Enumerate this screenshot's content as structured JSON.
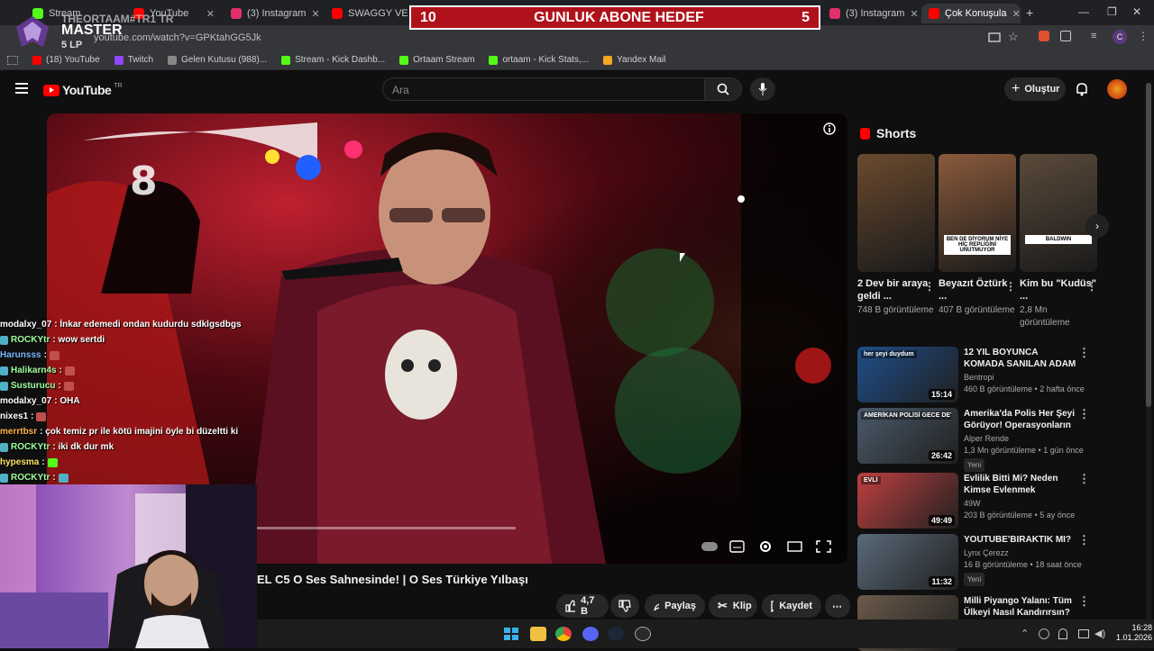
{
  "browser": {
    "tabs": [
      {
        "label": "Stream",
        "favicon_color": "#53fc18"
      },
      {
        "label": "YouTube",
        "favicon_color": "#ff0000"
      },
      {
        "label": "(3) Instagram",
        "favicon_color": "#e1306c"
      },
      {
        "label": "SWAGGY VE CAV",
        "favicon_color": "#ff0000"
      },
      {
        "label": "(3) Instagram",
        "favicon_color": "#e1306c"
      },
      {
        "label": "Çok Konuşula",
        "favicon_color": "#ff0000"
      }
    ],
    "new_tab_icon": "plus-icon",
    "url": "youtube.com/watch?v=GPKtahGG5Jk",
    "bookmarks": [
      {
        "label": "(18) YouTube",
        "color": "#ff0000"
      },
      {
        "label": "Twitch",
        "color": "#9146ff"
      },
      {
        "label": "Gelen Kutusu (988)...",
        "color": "#888888"
      },
      {
        "label": "Stream - Kick Dashb...",
        "color": "#53fc18"
      },
      {
        "label": "Ortaam Stream",
        "color": "#53fc18"
      },
      {
        "label": "ortaam - Kick Stats,...",
        "color": "#53fc18"
      },
      {
        "label": "Yandex Mail",
        "color": "#f5a623"
      }
    ]
  },
  "overlay": {
    "goal_left": "10",
    "goal_label": "GUNLUK ABONE HEDEF",
    "goal_right": "5",
    "streamer_name": "THEORTAAM#TR1 TR",
    "rank": "MASTER",
    "lp": "5 LP"
  },
  "youtube": {
    "logo_text": "YouTube",
    "region": "TR",
    "search_placeholder": "Ara",
    "create_label": "Oluştur",
    "video_title": "EL C5 O Ses Sahnesinde! | O Ses Türkiye Yılbaşı",
    "actions": {
      "likes": "4,7 B",
      "share": "Paylaş",
      "clip": "Klip",
      "save": "Kaydet"
    }
  },
  "chat": [
    {
      "user": "modalxy_07",
      "color": "#ffffff",
      "msg": ": İnkar edemedi ondan kudurdu sdklgsdbgs",
      "emote": ""
    },
    {
      "user": "ROCKYtr",
      "color": "#9effa0",
      "msg": ": wow sertdi",
      "emote": ""
    },
    {
      "user": "Harunsss",
      "color": "#7ab8ff",
      "msg": ":",
      "emote": "#c0504d"
    },
    {
      "user": "Halikarn4s",
      "color": "#9effa0",
      "msg": ":",
      "emote": "#c0504d"
    },
    {
      "user": "Susturucu",
      "color": "#9effa0",
      "msg": ":",
      "emote": "#c0504d"
    },
    {
      "user": "modalxy_07",
      "color": "#ffffff",
      "msg": ": OHA",
      "emote": ""
    },
    {
      "user": "nixes1",
      "color": "#ffffff",
      "msg": ":",
      "emote": "#c0504d"
    },
    {
      "user": "merrtbsr",
      "color": "#ffb347",
      "msg": ": çok temiz pr ile kötü imajini öyle bi düzeltti ki",
      "emote": ""
    },
    {
      "user": "ROCKYtr",
      "color": "#9effa0",
      "msg": ": iki dk dur mk",
      "emote": ""
    },
    {
      "user": "hypesma",
      "color": "#ffe066",
      "msg": ":",
      "emote": "#53fc18"
    },
    {
      "user": "ROCKYtr",
      "color": "#9effa0",
      "msg": ":",
      "emote": "#4fb0c6"
    }
  ],
  "shorts": {
    "title": "Shorts",
    "items": [
      {
        "title": "2 Dev bir araya geldi ...",
        "views": "748 B görüntüleme",
        "color": "#6b4a2e"
      },
      {
        "title": "Beyazıt Öztürk ...",
        "views": "407 B görüntüleme",
        "color": "#8a5a3c",
        "caption": "BEN DE DİYORUM NİYE HİÇ REPLİĞİNİ UNUTMUYOR"
      },
      {
        "title": "Kim bu \"Kudüs\" ...",
        "views": "2,8 Mn görüntüleme",
        "color": "#5a4a3a",
        "caption": "BALDWIN"
      }
    ]
  },
  "recommendations": [
    {
      "title": "12 YIL BOYUNCA KOMADA SANILAN ADAM",
      "channel": "Bentropi",
      "meta": "460 B görüntüleme • 2 hafta önce",
      "duration": "15:14",
      "badge": "",
      "color": "#1e4e8a",
      "caption": "her şeyi duydum"
    },
    {
      "title": "Amerika'da Polis Her Şeyi Görüyor! Operasyonların Perde...",
      "channel": "Alper Rende",
      "meta": "1,3 Mn görüntüleme • 1 gün önce",
      "duration": "26:42",
      "badge": "Yeni",
      "color": "#4a5a6a",
      "caption": "AMERİKAN POLİSİ GECE DEVRİYESİ"
    },
    {
      "title": "Evlilik Bitti Mi? Neden Kimse Evlenmek İstemiyor?",
      "channel": "49W",
      "meta": "203 B görüntüleme • 5 ay önce",
      "duration": "49:49",
      "badge": "",
      "color": "#c04040",
      "caption": "EVLİ"
    },
    {
      "title": "YOUTUBE'BIRAKTIK MI?",
      "channel": "Lynx Çerezz",
      "meta": "16 B görüntüleme • 18 saat önce",
      "duration": "11:32",
      "badge": "Yeni",
      "color": "#5a6a7a",
      "caption": ""
    },
    {
      "title": "Milli Piyango Yalanı: Tüm Ülkeyi Nasıl Kandırırsın?",
      "channel": "",
      "meta": "",
      "duration": "",
      "badge": "",
      "color": "#6a5a4a",
      "caption": ""
    }
  ],
  "system": {
    "time": "16:28",
    "date": "1.01.2026"
  }
}
